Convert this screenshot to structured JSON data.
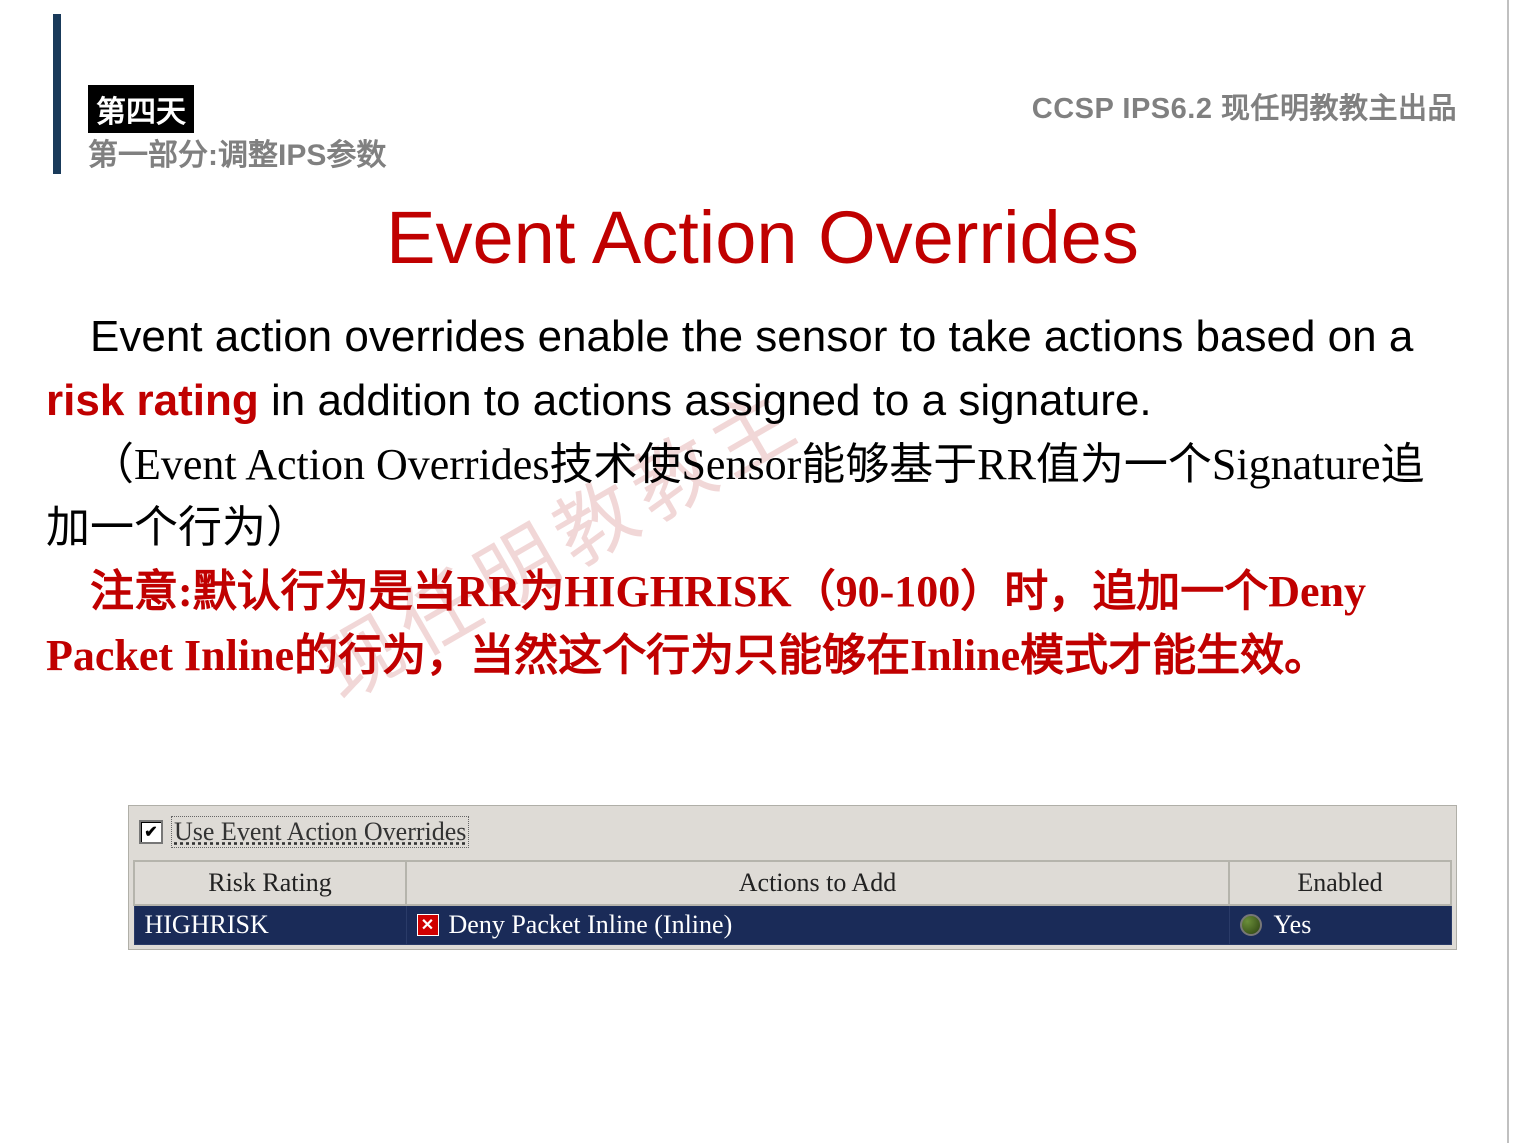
{
  "header": {
    "day": "第四天",
    "section": "第一部分:调整IPS参数",
    "brand": "CCSP IPS6.2  现任明教教主出品"
  },
  "title": "Event Action Overrides",
  "body": {
    "p1_lead": "Event action overrides enable the sensor to take actions based on a ",
    "p1_emph": "risk rating",
    "p1_tail": " in addition to actions assigned to a signature.",
    "p2": "（Event Action Overrides技术使Sensor能够基于RR值为一个Signature追加一个行为）",
    "p3": "注意:默认行为是当RR为HIGHRISK（90-100）时，追加一个Deny Packet Inline的行为，当然这个行为只能够在Inline模式才能生效。"
  },
  "watermark": "现任明教教主",
  "panel": {
    "checkbox_checked": true,
    "checkbox_label": "Use Event Action Overrides",
    "columns": {
      "c1": "Risk Rating",
      "c2": "Actions to Add",
      "c3": "Enabled"
    },
    "row": {
      "risk": "HIGHRISK",
      "action": "Deny Packet Inline (Inline)",
      "enabled": "Yes"
    }
  }
}
